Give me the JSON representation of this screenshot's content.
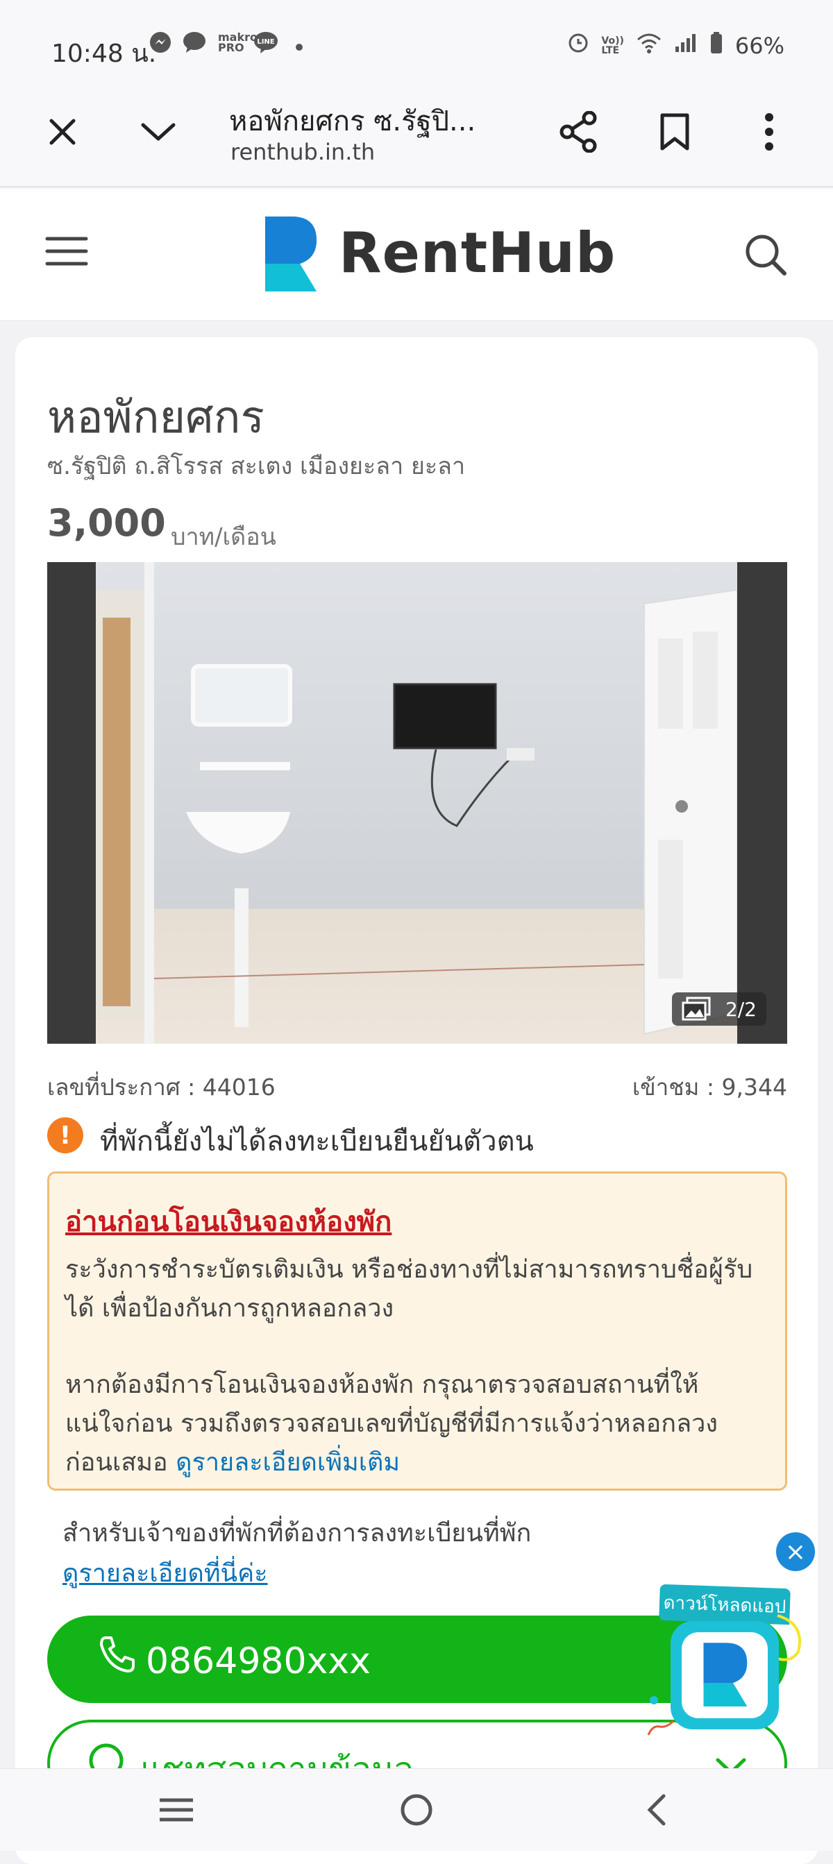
{
  "status_bar": {
    "time": "10:48 น.",
    "battery": "66%",
    "notification_icons": [
      "messenger-icon",
      "chat-icon",
      "makro-pro-icon",
      "line-icon",
      "dot-icon"
    ],
    "system_icons": [
      "alarm-icon",
      "volte-icon",
      "wifi-icon",
      "signal-icon",
      "battery-icon"
    ]
  },
  "browser": {
    "page_title": "หอพักยศกร ซ.รัฐปิ...",
    "url": "renthub.in.th"
  },
  "site": {
    "brand": "RentHub"
  },
  "listing": {
    "title": "หอพักยศกร",
    "address": "ซ.รัฐปิติ ถ.สิโรรส สะเตง เมืองยะลา ยะลา",
    "price": "3,000",
    "price_unit": "บาท/เดือน",
    "photo_counter": "2/2",
    "listing_id": "เลขที่ประกาศ : 44016",
    "views": "เข้าชม : 9,344",
    "unverified": "ที่พักนี้ยังไม่ได้ลงทะเบียนยืนยันตัวตน"
  },
  "notice": {
    "title": "อ่านก่อนโอนเงินจองห้องพัก",
    "line1": "ระวังการชำระบัตรเติมเงิน หรือช่องทางที่ไม่สามารถทราบชื่อผู้รับ",
    "line2": "ได้ เพื่อป้องกันการถูกหลอกลวง",
    "line3": "หากต้องมีการโอนเงินจองห้องพัก กรุณาตรวจสอบสถานที่ให้",
    "line4": "แน่ใจก่อน รวมถึงตรวจสอบเลขที่บัญชีที่มีการแจ้งว่าหลอกลวง",
    "line5": "ก่อนเสมอ",
    "link": "ดูรายละเอียดเพิ่มเติม"
  },
  "owner": {
    "text": "สำหรับเจ้าของที่พักที่ต้องการลงทะเบียนที่พัก",
    "link": "ดูรายละเอียดที่นี่ค่ะ"
  },
  "actions": {
    "phone": "0864980xxx",
    "chat": "แชทสอบถามข้อมูล"
  },
  "download_widget": {
    "label": "ดาวน์โหลดแอป"
  },
  "colors": {
    "brand_blue": "#1a8ad8",
    "call_green": "#13b418",
    "warning_orange": "#f47c20",
    "notice_red": "#c8191f"
  }
}
